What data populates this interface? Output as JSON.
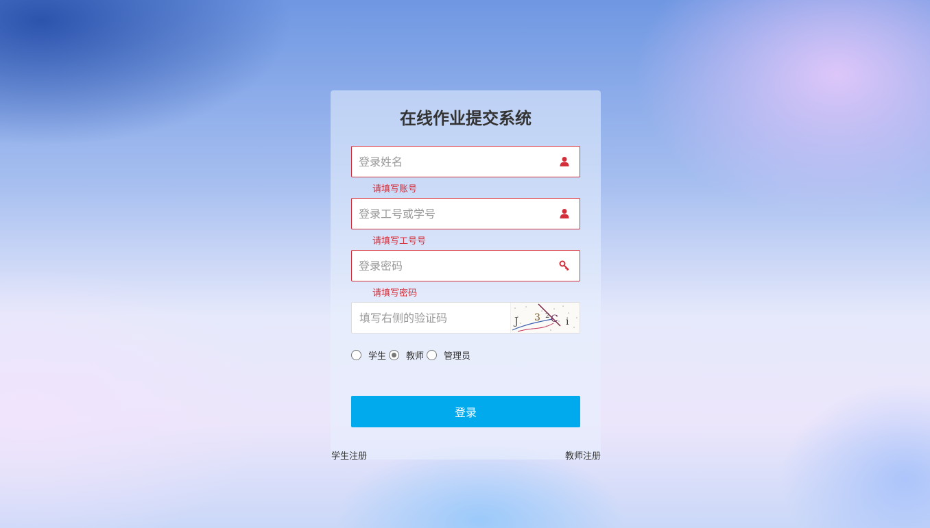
{
  "title": "在线作业提交系统",
  "form": {
    "username": {
      "placeholder": "登录姓名",
      "value": "",
      "error": "请填写账号",
      "icon": "user-icon"
    },
    "id_number": {
      "placeholder": "登录工号或学号",
      "value": "",
      "error": "请填写工号号",
      "icon": "user-icon"
    },
    "password": {
      "placeholder": "登录密码",
      "value": "",
      "error": "请填写密码",
      "icon": "key-icon"
    },
    "captcha": {
      "placeholder": "填写右侧的验证码",
      "value": "",
      "image_text": "J32Ci"
    }
  },
  "roles": [
    {
      "label": "学生",
      "checked": false
    },
    {
      "label": "教师",
      "checked": true
    },
    {
      "label": "管理员",
      "checked": false
    }
  ],
  "login_label": "登录",
  "links": {
    "student_register": "学生注册",
    "teacher_register": "教师注册"
  },
  "colors": {
    "accent": "#01aaed",
    "error": "#d32f3a"
  }
}
